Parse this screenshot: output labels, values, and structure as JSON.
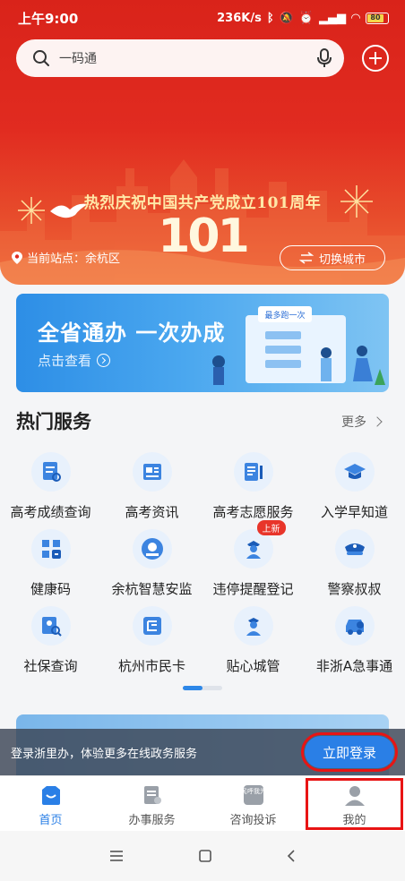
{
  "status_bar": {
    "time": "上午9:00",
    "net_speed": "236K/s",
    "battery": "80"
  },
  "search": {
    "placeholder": "一码通"
  },
  "banner": {
    "title": "热烈庆祝中国共产党成立101周年",
    "number": "101"
  },
  "location": {
    "label": "当前站点：余杭区",
    "switch_label": "切换城市"
  },
  "promo": {
    "title": "全省通办 一次办成",
    "cta": "点击查看",
    "tag": "最多跑一次"
  },
  "hot_services": {
    "title": "热门服务",
    "more": "更多"
  },
  "services": [
    {
      "label": "高考成绩查询",
      "icon": "exam-score-icon"
    },
    {
      "label": "高考资讯",
      "icon": "news-icon"
    },
    {
      "label": "高考志愿服务",
      "icon": "volunteer-form-icon"
    },
    {
      "label": "入学早知道",
      "icon": "graduation-cap-icon"
    },
    {
      "label": "健康码",
      "icon": "health-code-icon"
    },
    {
      "label": "余杭智慧安监",
      "icon": "safety-badge-icon"
    },
    {
      "label": "违停提醒登记",
      "icon": "traffic-officer-icon",
      "badge": "上新"
    },
    {
      "label": "警察叔叔",
      "icon": "police-cap-icon"
    },
    {
      "label": "社保查询",
      "icon": "social-security-icon"
    },
    {
      "label": "杭州市民卡",
      "icon": "citizen-card-icon"
    },
    {
      "label": "贴心城管",
      "icon": "city-manager-icon"
    },
    {
      "label": "非浙A急事通",
      "icon": "car-icon"
    }
  ],
  "login_bar": {
    "message": "登录浙里办，体验更多在线政务服务",
    "button": "立即登录"
  },
  "tabs": [
    {
      "label": "首页",
      "icon": "home-icon"
    },
    {
      "label": "办事服务",
      "icon": "service-doc-icon"
    },
    {
      "label": "咨询投诉",
      "icon": "complaint-icon",
      "icon_text": "民呼我为"
    },
    {
      "label": "我的",
      "icon": "user-icon"
    }
  ],
  "colors": {
    "brand_red": "#e12b20",
    "accent_blue": "#2a7fe6",
    "highlight_red": "#e81414"
  }
}
